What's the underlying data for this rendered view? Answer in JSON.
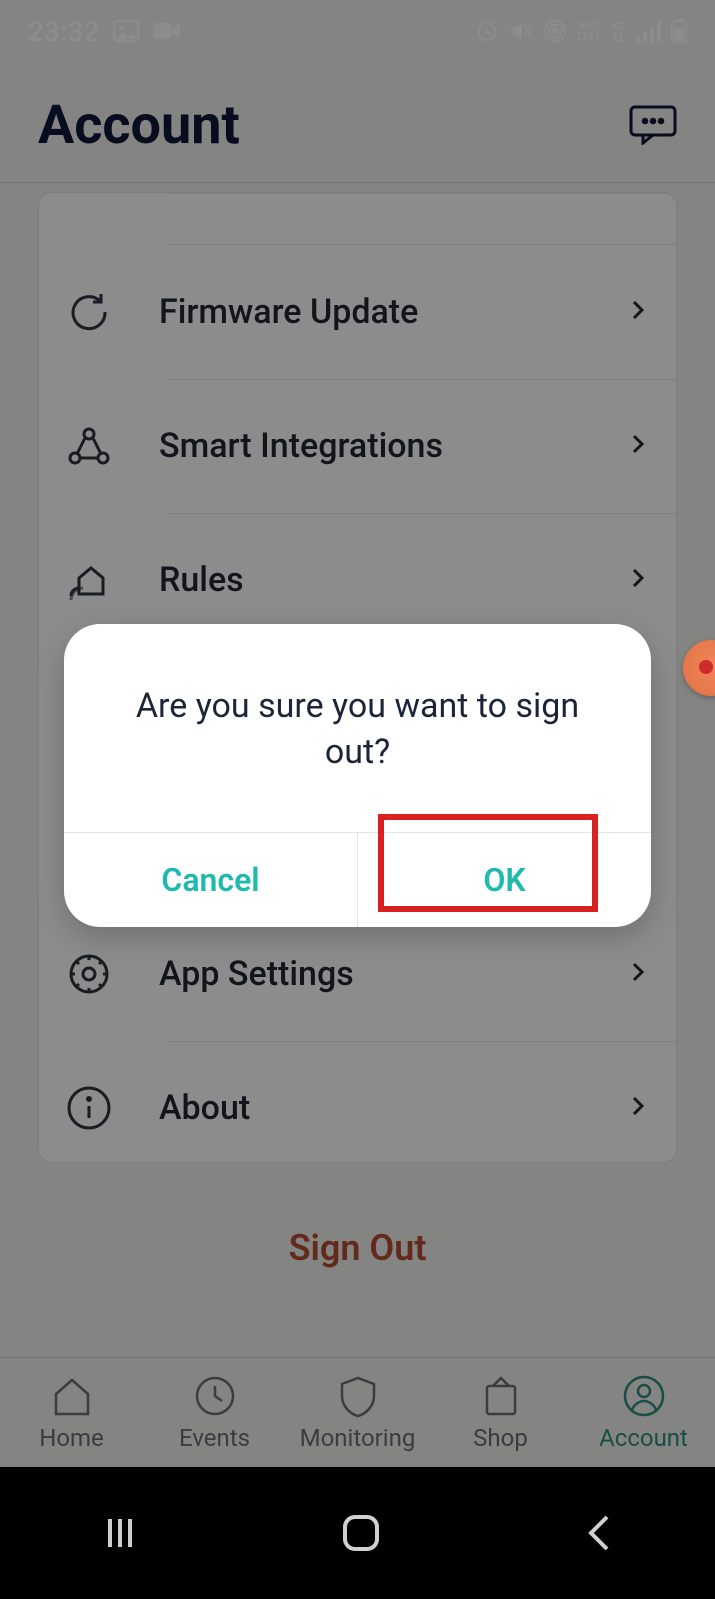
{
  "status": {
    "time": "23:32",
    "lte_label": "Vo))",
    "lte_sub": "LTE1",
    "net": "4G"
  },
  "header": {
    "title": "Account"
  },
  "list": [
    {
      "label": "Firmware Update",
      "icon": "refresh-icon"
    },
    {
      "label": "Smart Integrations",
      "icon": "share-nodes-icon"
    },
    {
      "label": "Rules",
      "icon": "home-signal-icon"
    },
    {
      "label": "App Settings",
      "icon": "gear-icon"
    },
    {
      "label": "About",
      "icon": "info-icon"
    }
  ],
  "signout_label": "Sign Out",
  "tabs": [
    {
      "label": "Home"
    },
    {
      "label": "Events"
    },
    {
      "label": "Monitoring"
    },
    {
      "label": "Shop"
    },
    {
      "label": "Account"
    }
  ],
  "modal": {
    "message": "Are you sure you want to sign out?",
    "cancel": "Cancel",
    "ok": "OK"
  }
}
